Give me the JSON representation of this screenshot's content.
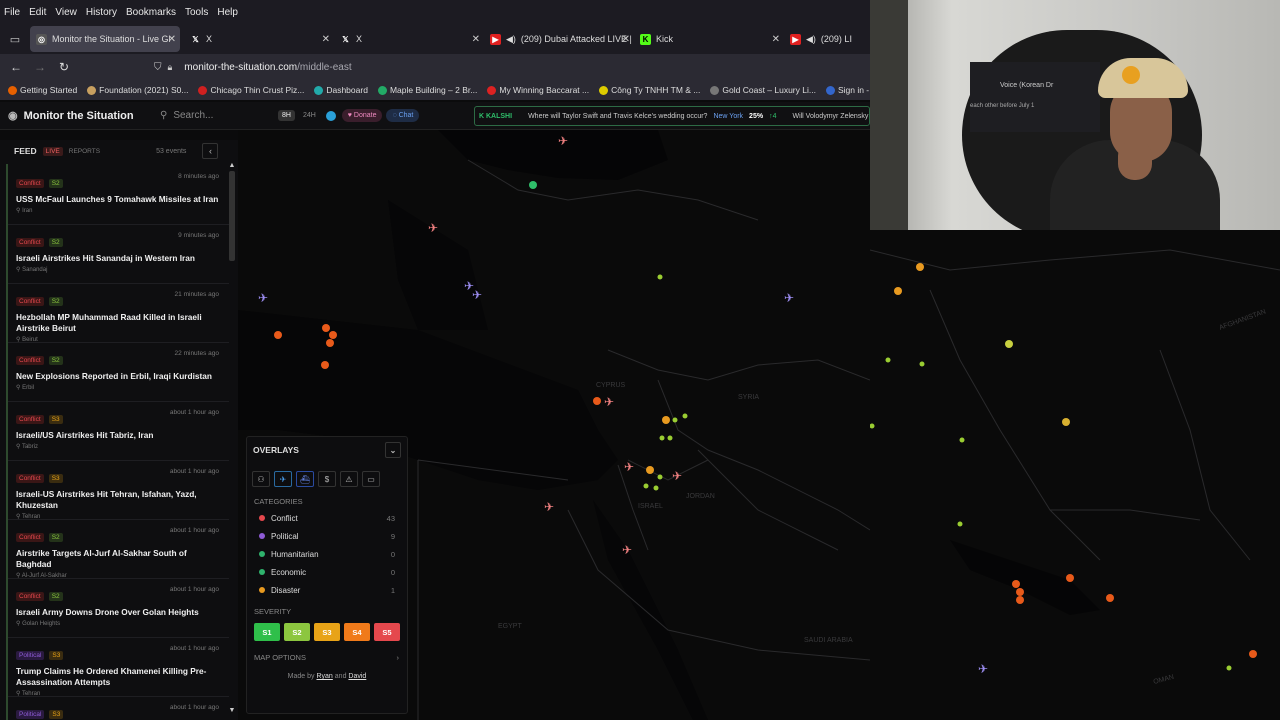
{
  "menubar": [
    "File",
    "Edit",
    "View",
    "History",
    "Bookmarks",
    "Tools",
    "Help"
  ],
  "tabs": [
    {
      "label": "Monitor the Situation - Live Gl",
      "fav": "MS",
      "fav_color": "#555",
      "active": true
    },
    {
      "label": "X",
      "fav": "X",
      "fav_color": "#000"
    },
    {
      "label": "X",
      "fav": "X",
      "fav_color": "#000"
    },
    {
      "label": "(209) Dubai Attacked LIVE |",
      "fav": "▶",
      "fav_color": "#e02020"
    },
    {
      "label": "Kick",
      "fav": "K",
      "fav_color": "#53fc18"
    },
    {
      "label": "(209) LI",
      "fav": "▶",
      "fav_color": "#e02020"
    }
  ],
  "url": {
    "host": "monitor-the-situation.com",
    "path": "/middle-east"
  },
  "bookmarks": [
    {
      "label": "Getting Started",
      "color": "#e66000"
    },
    {
      "label": "Foundation (2021) S0...",
      "color": "#c8a060"
    },
    {
      "label": "Chicago Thin Crust Piz...",
      "color": "#d02020"
    },
    {
      "label": "Dashboard",
      "color": "#2aa"
    },
    {
      "label": "Maple Building – 2 Br...",
      "color": "#2a6"
    },
    {
      "label": "My Winning Baccarat ...",
      "color": "#d22"
    },
    {
      "label": "Công Ty TNHH TM & ...",
      "color": "#dc0"
    },
    {
      "label": "Gold Coast – Luxury Li...",
      "color": "#777"
    },
    {
      "label": "Sign in - Drea",
      "color": "#36c"
    }
  ],
  "app": {
    "brand": "Monitor the Situation",
    "search_placeholder": "Search...",
    "btn_8h": "8H",
    "btn_24h": "24H",
    "donate": "♥ Donate",
    "chat": "◌ Chat",
    "ticker_source": "KALSHI",
    "ticker_q1": "Where will Taylor Swift and Travis Kelce's wedding occur?",
    "ticker_ny": "New York",
    "ticker_pct": "25%",
    "ticker_chg": "↑4",
    "ticker_q2": "Will Volodymyr Zelensky"
  },
  "feed": {
    "label": "FEED",
    "live": "LIVE",
    "reports": "REPORTS",
    "count": "53 events",
    "items": [
      {
        "cat": "Conflict",
        "sev": "S2",
        "time": "8 minutes ago",
        "title": "USS McFaul Launches 9 Tomahawk Missiles at Iran",
        "loc": "Iran"
      },
      {
        "cat": "Conflict",
        "sev": "S2",
        "time": "9 minutes ago",
        "title": "Israeli Airstrikes Hit Sanandaj in Western Iran",
        "loc": "Sanandaj"
      },
      {
        "cat": "Conflict",
        "sev": "S2",
        "time": "21 minutes ago",
        "title": "Hezbollah MP Muhammad Raad Killed in Israeli Airstrike Beirut",
        "loc": "Beirut"
      },
      {
        "cat": "Conflict",
        "sev": "S2",
        "time": "22 minutes ago",
        "title": "New Explosions Reported in Erbil, Iraqi Kurdistan",
        "loc": "Erbil"
      },
      {
        "cat": "Conflict",
        "sev": "S3",
        "time": "about 1 hour ago",
        "title": "Israeli/US Airstrikes Hit Tabriz, Iran",
        "loc": "Tabriz"
      },
      {
        "cat": "Conflict",
        "sev": "S3",
        "time": "about 1 hour ago",
        "title": "Israeli-US Airstrikes Hit Tehran, Isfahan, Yazd, Khuzestan",
        "loc": "Tehran"
      },
      {
        "cat": "Conflict",
        "sev": "S2",
        "time": "about 1 hour ago",
        "title": "Airstrike Targets Al-Jurf Al-Sakhar South of Baghdad",
        "loc": "Al-Jurf Al-Sakhar"
      },
      {
        "cat": "Conflict",
        "sev": "S2",
        "time": "about 1 hour ago",
        "title": "Israeli Army Downs Drone Over Golan Heights",
        "loc": "Golan Heights"
      },
      {
        "cat": "Political",
        "sev": "S3",
        "time": "about 1 hour ago",
        "title": "Trump Claims He Ordered Khamenei Killing Pre-Assassination Attempts",
        "loc": "Tehran"
      },
      {
        "cat": "Political",
        "sev": "S3",
        "time": "about 1 hour ago",
        "title": "",
        "loc": ""
      }
    ]
  },
  "overlays": {
    "title": "OVERLAYS",
    "categories_label": "CATEGORIES",
    "categories": [
      {
        "name": "Conflict",
        "count": "43",
        "color": "#e5484d"
      },
      {
        "name": "Political",
        "count": "9",
        "color": "#8e5bd6"
      },
      {
        "name": "Humanitarian",
        "count": "0",
        "color": "#2fb36d"
      },
      {
        "name": "Economic",
        "count": "0",
        "color": "#2fb36d"
      },
      {
        "name": "Disaster",
        "count": "1",
        "color": "#e89a20"
      }
    ],
    "severity_label": "SEVERITY",
    "severity": [
      {
        "label": "S1",
        "color": "#2fbf4a"
      },
      {
        "label": "S2",
        "color": "#8cc63f"
      },
      {
        "label": "S3",
        "color": "#e8a317"
      },
      {
        "label": "S4",
        "color": "#f07a1a"
      },
      {
        "label": "S5",
        "color": "#e5484d"
      }
    ],
    "map_options": "MAP OPTIONS",
    "credit_prefix": "Made by",
    "credit_a": "Ryan",
    "credit_and": "and",
    "credit_b": "David"
  },
  "map_labels": {
    "cyprus": "CYPRUS",
    "syria": "SYRIA",
    "jordan": "JORDAN",
    "israel": "ISRAEL",
    "egypt": "EGYPT",
    "saudi": "SAUDI ARABIA",
    "oman": "OMAN",
    "afghanistan": "AFGHANISTAN"
  },
  "webcam_overlay": {
    "tab_text": "Voice (Korean Dr",
    "sub_text": "each other before July 1"
  }
}
